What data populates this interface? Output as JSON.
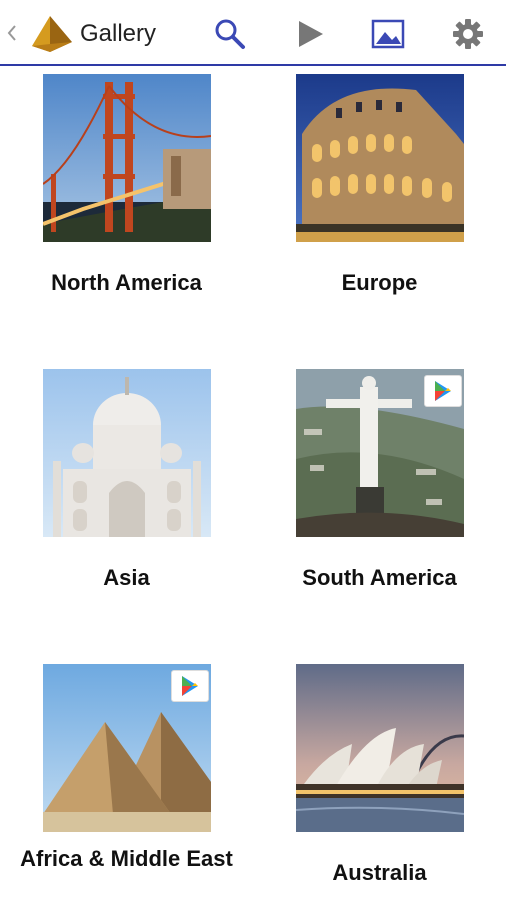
{
  "actionbar": {
    "title": "Gallery",
    "icons": [
      "up-caret-icon",
      "app-pyramid-icon",
      "search-icon",
      "play-icon",
      "gallery-icon",
      "gear-icon"
    ],
    "accent": "#2e3aa6"
  },
  "regions": [
    {
      "label": "North America",
      "image": "golden-gate-bridge",
      "store_badge": false
    },
    {
      "label": "Europe",
      "image": "colosseum",
      "store_badge": false
    },
    {
      "label": "Asia",
      "image": "taj-mahal",
      "store_badge": false
    },
    {
      "label": "South America",
      "image": "christ-the-redeemer",
      "store_badge": true
    },
    {
      "label": "Africa & Middle East",
      "image": "pyramids",
      "store_badge": true
    },
    {
      "label": "Australia",
      "image": "sydney-opera-house",
      "store_badge": false
    }
  ]
}
